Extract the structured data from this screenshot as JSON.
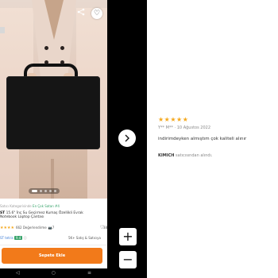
{
  "product": {
    "seller_line": "Satıcı Kategorisinde",
    "seller_badge": "En Çok Satan #4",
    "title_brand": "ST",
    "title_text": "15.6\" İnç Su Geçirmez Kumaş Özellikli Evrak Notebook Laptop Çantası",
    "rating_text": "662 Değerlendirme",
    "review_badge": "7",
    "favorites": "38",
    "seller_name": "ST tetris",
    "seller_score": "9.4",
    "sold_text": "5K+ Satış & Satıcıya",
    "add_to_cart": "Sepete Ekle",
    "icons": {
      "share": "share-icon",
      "favorite": "heart-icon",
      "heart_small": "heart-icon"
    },
    "colors": {
      "accent": "#f27a1a",
      "star": "#f4a81d",
      "score_badge": "#36a36a"
    }
  },
  "review": {
    "stars": "★★★★★",
    "author": "Y** M**",
    "date": "10 Ağustos 2022",
    "text": "indirimdeyken almıştım çok kaliteli alınır",
    "seller_name": "KIMICH",
    "seller_suffix": "satıcısından alındı."
  },
  "controls": {
    "next": "chevron-right-icon",
    "zoom_in": "+",
    "zoom_out": "−"
  },
  "nav": {
    "back": "◁",
    "home": "○",
    "recent": "≡"
  }
}
